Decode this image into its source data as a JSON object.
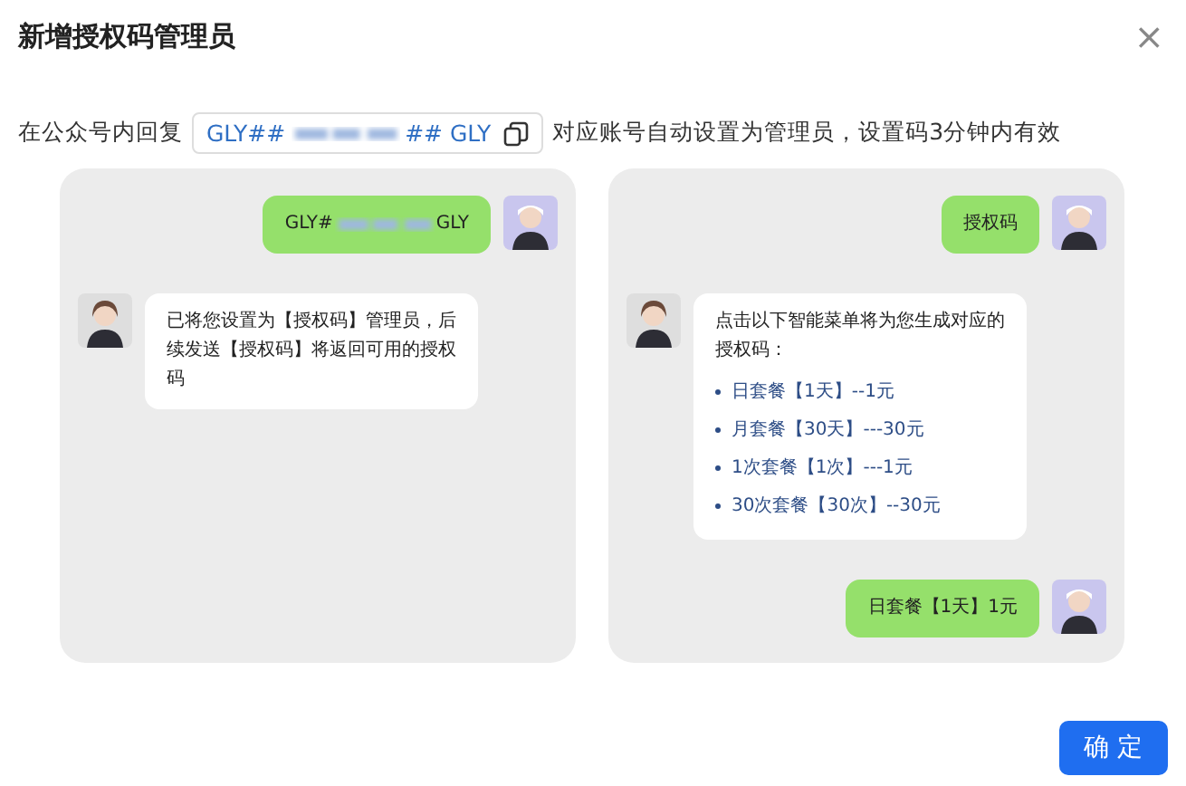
{
  "dialog": {
    "title": "新增授权码管理员",
    "close": "×"
  },
  "instruction": {
    "before": "在公众号内回复",
    "code_prefix": "GLY##",
    "code_suffix": "## GLY",
    "after": "对应账号自动设置为管理员，设置码3分钟内有效"
  },
  "chats": [
    {
      "messages": [
        {
          "kind": "code",
          "outgoing": true,
          "prefix": "GLY#",
          "suffix": "GLY"
        },
        {
          "kind": "text",
          "outgoing": false,
          "text": "已将您设置为【授权码】管理员，后续发送【授权码】将返回可用的授权码"
        }
      ]
    },
    {
      "messages": [
        {
          "kind": "text",
          "outgoing": true,
          "text": "授权码"
        },
        {
          "kind": "menu",
          "outgoing": false,
          "text": "点击以下智能菜单将为您生成对应的授权码：",
          "items": [
            "日套餐【1天】--1元",
            "月套餐【30天】---30元",
            "1次套餐【1次】---1元",
            "30次套餐【30次】--30元"
          ]
        },
        {
          "kind": "text",
          "outgoing": true,
          "text": "日套餐【1天】1元"
        }
      ]
    }
  ],
  "confirm_button": "确 定"
}
